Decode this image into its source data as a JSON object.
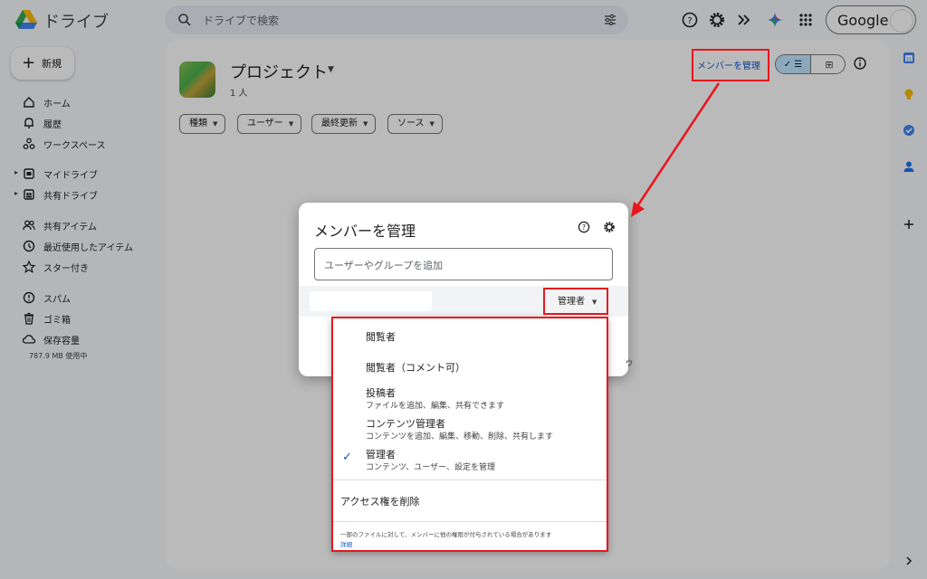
{
  "header": {
    "app_title": "ドライブ",
    "search_placeholder": "ドライブで検索",
    "account_brand": "Google"
  },
  "sidebar": {
    "new_label": "新規",
    "items": [
      {
        "label": "ホーム",
        "icon": "home-icon"
      },
      {
        "label": "履歴",
        "icon": "bell-icon"
      },
      {
        "label": "ワークスペース",
        "icon": "workspace-icon"
      },
      {
        "label": "マイドライブ",
        "icon": "my-drive-icon"
      },
      {
        "label": "共有ドライブ",
        "icon": "shared-drive-icon"
      },
      {
        "label": "共有アイテム",
        "icon": "people-icon"
      },
      {
        "label": "最近使用したアイテム",
        "icon": "clock-icon"
      },
      {
        "label": "スター付き",
        "icon": "star-icon"
      },
      {
        "label": "スパム",
        "icon": "spam-icon"
      },
      {
        "label": "ゴミ箱",
        "icon": "trash-icon"
      },
      {
        "label": "保存容量",
        "icon": "cloud-icon"
      }
    ],
    "storage_used": "787.9 MB 使用中"
  },
  "main": {
    "project_title": "プロジェクト",
    "member_count": "1 人",
    "manage_members_link": "メンバーを管理",
    "filters": [
      "種類",
      "ユーザー",
      "最終更新",
      "ソース"
    ]
  },
  "dialog": {
    "title": "メンバーを管理",
    "add_placeholder": "ユーザーやグループを追加",
    "current_role": "管理者"
  },
  "role_menu": {
    "options": [
      {
        "label": "閲覧者",
        "desc": ""
      },
      {
        "label": "閲覧者（コメント可）",
        "desc": ""
      },
      {
        "label": "投稿者",
        "desc": "ファイルを追加、編集、共有できます"
      },
      {
        "label": "コンテンツ管理者",
        "desc": "コンテンツを追加、編集、移動、削除、共有します"
      },
      {
        "label": "管理者",
        "desc": "コンテンツ、ユーザー、設定を管理"
      }
    ],
    "selected_index": 4,
    "remove_access": "アクセス権を削除",
    "footnote": "一部のファイルに対して、メンバーに他の権限が付与されている場合があります",
    "details_link": "詳細"
  },
  "colors": {
    "accent": "#0b57d0",
    "annotation_red": "#e8161d",
    "selected_toggle": "#c2e7ff"
  }
}
